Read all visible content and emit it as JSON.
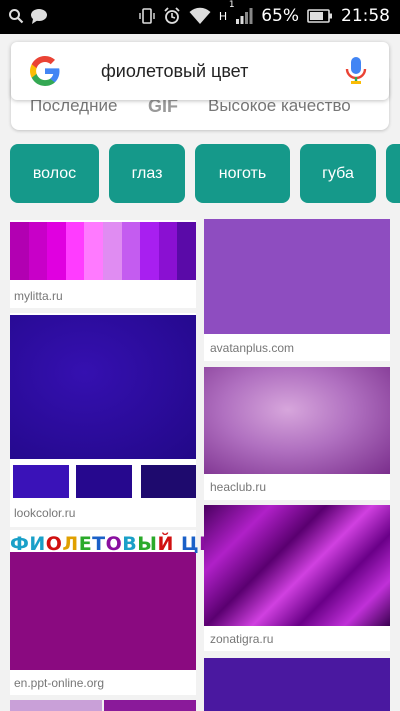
{
  "status_bar": {
    "network_letter": "H",
    "signal_superscript": "1",
    "battery": "65%",
    "time": "21:58"
  },
  "search": {
    "query": "фиолетовый цвет"
  },
  "filters": [
    {
      "label": "Последние"
    },
    {
      "label": "GIF"
    },
    {
      "label": "Высокое качество"
    }
  ],
  "chips": [
    {
      "label": "волос"
    },
    {
      "label": "глаз"
    },
    {
      "label": "ноготь"
    },
    {
      "label": "губа"
    }
  ],
  "results": {
    "left": [
      {
        "source": "mylitta.ru",
        "swatches": [
          "#b200b2",
          "#c800c8",
          "#e000e0",
          "#ff3cff",
          "#ff7aff",
          "#e08cf2",
          "#c45cf0",
          "#a81ff0",
          "#8a10d2",
          "#5a0aa8"
        ]
      },
      {
        "source": "lookcolor.ru",
        "main": "#2a0a9e",
        "swatches": [
          "#3a12b8",
          "#26088e",
          "#1e0a6e"
        ]
      },
      {
        "source": "en.ppt-online.org",
        "title": "ФИОЛЕТОВЫЙ ЦВЕТ",
        "main": "#8a0a80"
      }
    ],
    "right": [
      {
        "source": "avatanplus.com",
        "main": "#8e4dc0"
      },
      {
        "source": "heaclub.ru",
        "main": "#9a4aa8"
      },
      {
        "source": "zonatigra.ru",
        "main": "#7a0a90"
      },
      {
        "main": "#4a18a0"
      }
    ]
  },
  "colors": {
    "chip": "#15998a",
    "google_blue": "#4285f4",
    "google_red": "#ea4335",
    "google_yellow": "#fbbc05",
    "google_green": "#34a853"
  }
}
